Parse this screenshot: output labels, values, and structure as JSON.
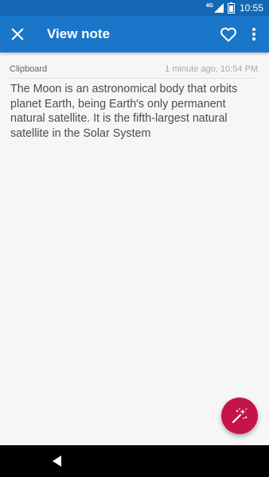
{
  "status_bar": {
    "network": "4G",
    "time": "10:55"
  },
  "app_bar": {
    "title": "View note",
    "close_icon": "close-icon",
    "favorite_icon": "heart-outline-icon",
    "more_icon": "more-vert-icon",
    "color": "#1976c9"
  },
  "note": {
    "source": "Clipboard",
    "timestamp": "1 minute ago, 10:54 PM",
    "body": "The Moon is an astronomical body that orbits planet Earth, being Earth's only permanent natural satellite. It is the fifth-largest natural satellite in the Solar System"
  },
  "fab": {
    "icon": "magic-wand-icon",
    "color": "#c4144a"
  },
  "nav_bar": {
    "back_icon": "back-triangle-icon"
  }
}
